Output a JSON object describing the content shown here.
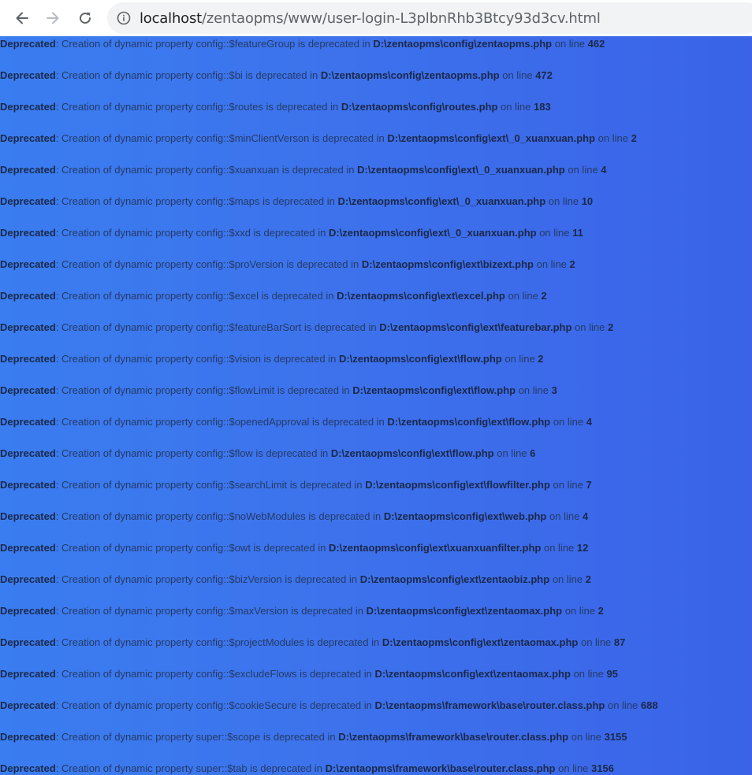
{
  "browser": {
    "url_host": "localhost",
    "url_path": "/zentaopms/www/user-login-L3plbnRhb3Btcy93d3cv.html"
  },
  "log": {
    "level_label": "Deprecated",
    "lines": [
      {
        "prefix": ": Creation of dynamic property config::$featureGroup is deprecated in ",
        "file": "D:\\zentaopms\\config\\zentaopms.php",
        "mid": " on line ",
        "num": "462"
      },
      {
        "prefix": ": Creation of dynamic property config::$bi is deprecated in ",
        "file": "D:\\zentaopms\\config\\zentaopms.php",
        "mid": " on line ",
        "num": "472"
      },
      {
        "prefix": ": Creation of dynamic property config::$routes is deprecated in ",
        "file": "D:\\zentaopms\\config\\routes.php",
        "mid": " on line ",
        "num": "183"
      },
      {
        "prefix": ": Creation of dynamic property config::$minClientVerson is deprecated in ",
        "file": "D:\\zentaopms\\config\\ext\\_0_xuanxuan.php",
        "mid": " on line ",
        "num": "2"
      },
      {
        "prefix": ": Creation of dynamic property config::$xuanxuan is deprecated in ",
        "file": "D:\\zentaopms\\config\\ext\\_0_xuanxuan.php",
        "mid": " on line ",
        "num": "4"
      },
      {
        "prefix": ": Creation of dynamic property config::$maps is deprecated in ",
        "file": "D:\\zentaopms\\config\\ext\\_0_xuanxuan.php",
        "mid": " on line ",
        "num": "10"
      },
      {
        "prefix": ": Creation of dynamic property config::$xxd is deprecated in ",
        "file": "D:\\zentaopms\\config\\ext\\_0_xuanxuan.php",
        "mid": " on line ",
        "num": "11"
      },
      {
        "prefix": ": Creation of dynamic property config::$proVersion is deprecated in ",
        "file": "D:\\zentaopms\\config\\ext\\bizext.php",
        "mid": " on line ",
        "num": "2"
      },
      {
        "prefix": ": Creation of dynamic property config::$excel is deprecated in ",
        "file": "D:\\zentaopms\\config\\ext\\excel.php",
        "mid": " on line ",
        "num": "2"
      },
      {
        "prefix": ": Creation of dynamic property config::$featureBarSort is deprecated in ",
        "file": "D:\\zentaopms\\config\\ext\\featurebar.php",
        "mid": " on line ",
        "num": "2"
      },
      {
        "prefix": ": Creation of dynamic property config::$vision is deprecated in ",
        "file": "D:\\zentaopms\\config\\ext\\flow.php",
        "mid": " on line ",
        "num": "2"
      },
      {
        "prefix": ": Creation of dynamic property config::$flowLimit is deprecated in ",
        "file": "D:\\zentaopms\\config\\ext\\flow.php",
        "mid": " on line ",
        "num": "3"
      },
      {
        "prefix": ": Creation of dynamic property config::$openedApproval is deprecated in ",
        "file": "D:\\zentaopms\\config\\ext\\flow.php",
        "mid": " on line ",
        "num": "4"
      },
      {
        "prefix": ": Creation of dynamic property config::$flow is deprecated in ",
        "file": "D:\\zentaopms\\config\\ext\\flow.php",
        "mid": " on line ",
        "num": "6"
      },
      {
        "prefix": ": Creation of dynamic property config::$searchLimit is deprecated in ",
        "file": "D:\\zentaopms\\config\\ext\\flowfilter.php",
        "mid": " on line ",
        "num": "7"
      },
      {
        "prefix": ": Creation of dynamic property config::$noWebModules is deprecated in ",
        "file": "D:\\zentaopms\\config\\ext\\web.php",
        "mid": " on line ",
        "num": "4"
      },
      {
        "prefix": ": Creation of dynamic property config::$owt is deprecated in ",
        "file": "D:\\zentaopms\\config\\ext\\xuanxuanfilter.php",
        "mid": " on line ",
        "num": "12"
      },
      {
        "prefix": ": Creation of dynamic property config::$bizVersion is deprecated in ",
        "file": "D:\\zentaopms\\config\\ext\\zentaobiz.php",
        "mid": " on line ",
        "num": "2"
      },
      {
        "prefix": ": Creation of dynamic property config::$maxVersion is deprecated in ",
        "file": "D:\\zentaopms\\config\\ext\\zentaomax.php",
        "mid": " on line ",
        "num": "2"
      },
      {
        "prefix": ": Creation of dynamic property config::$projectModules is deprecated in ",
        "file": "D:\\zentaopms\\config\\ext\\zentaomax.php",
        "mid": " on line ",
        "num": "87"
      },
      {
        "prefix": ": Creation of dynamic property config::$excludeFlows is deprecated in ",
        "file": "D:\\zentaopms\\config\\ext\\zentaomax.php",
        "mid": " on line ",
        "num": "95"
      },
      {
        "prefix": ": Creation of dynamic property config::$cookieSecure is deprecated in ",
        "file": "D:\\zentaopms\\framework\\base\\router.class.php",
        "mid": " on line ",
        "num": "688"
      },
      {
        "prefix": ": Creation of dynamic property super::$scope is deprecated in ",
        "file": "D:\\zentaopms\\framework\\base\\router.class.php",
        "mid": " on line ",
        "num": "3155"
      },
      {
        "prefix": ": Creation of dynamic property super::$tab is deprecated in ",
        "file": "D:\\zentaopms\\framework\\base\\router.class.php",
        "mid": " on line ",
        "num": "3156"
      }
    ]
  }
}
